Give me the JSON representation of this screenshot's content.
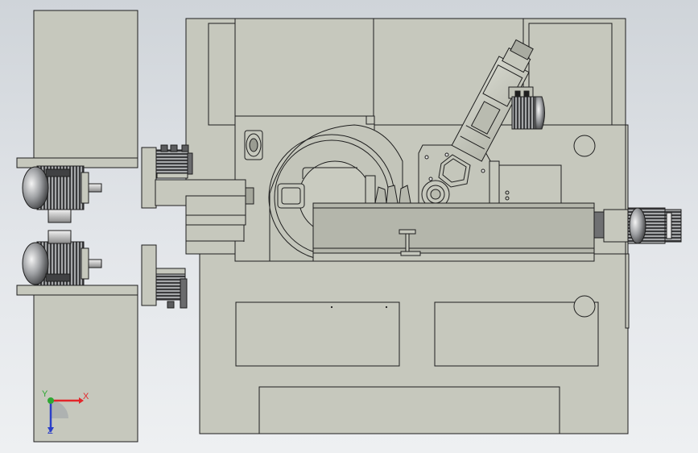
{
  "viewport": {
    "background_top": "#cfd4d9",
    "background_bottom": "#eef0f2",
    "part_fill": "#c6c8bd",
    "edge_color": "#1e1e1e"
  },
  "triad": {
    "x_label": "X",
    "y_label": "Y",
    "z_label": "Z",
    "x_color": "#e3262a",
    "y_color": "#2fa733",
    "z_color": "#2a3ec8"
  }
}
